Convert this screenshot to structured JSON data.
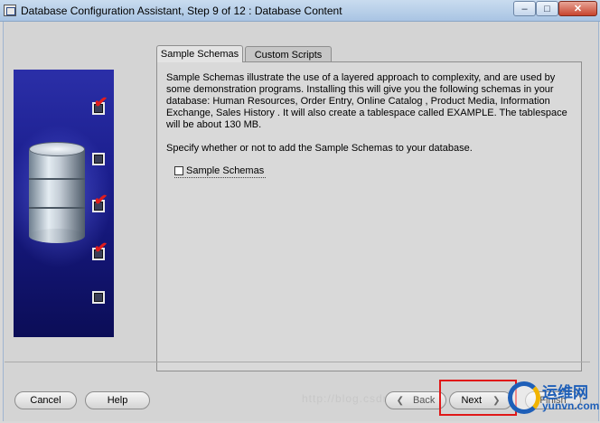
{
  "window": {
    "title": "Database Configuration Assistant, Step 9 of 12 : Database Content",
    "minimize_glyph": "–",
    "maximize_glyph": "□",
    "close_glyph": "✕"
  },
  "steps": [
    {
      "state": "checked"
    },
    {
      "state": "unchecked"
    },
    {
      "state": "checked"
    },
    {
      "state": "checked"
    },
    {
      "state": "unchecked"
    }
  ],
  "tabs": [
    {
      "label": "Sample Schemas",
      "active": true
    },
    {
      "label": "Custom Scripts",
      "active": false
    }
  ],
  "content": {
    "description": "Sample Schemas illustrate the use of a layered approach to complexity, and are used by some demonstration programs. Installing this will give you the following schemas in your database: Human Resources, Order Entry, Online Catalog , Product Media, Information Exchange, Sales History . It will also create a tablespace called EXAMPLE. The tablespace will be about 130 MB.",
    "prompt": "Specify whether or not to add the Sample Schemas to your database.",
    "checkbox_label": "Sample Schemas",
    "checkbox_checked": false
  },
  "buttons": {
    "cancel": "Cancel",
    "help": "Help",
    "back": "Back",
    "next": "Next",
    "finish": "Finish"
  },
  "watermark": "http://blog.csdn.net/",
  "logo": {
    "name_cn": "运维网",
    "domain": "yunvn.com"
  },
  "colors": {
    "highlight": "#e01818",
    "step_check": "#e11d1d"
  }
}
